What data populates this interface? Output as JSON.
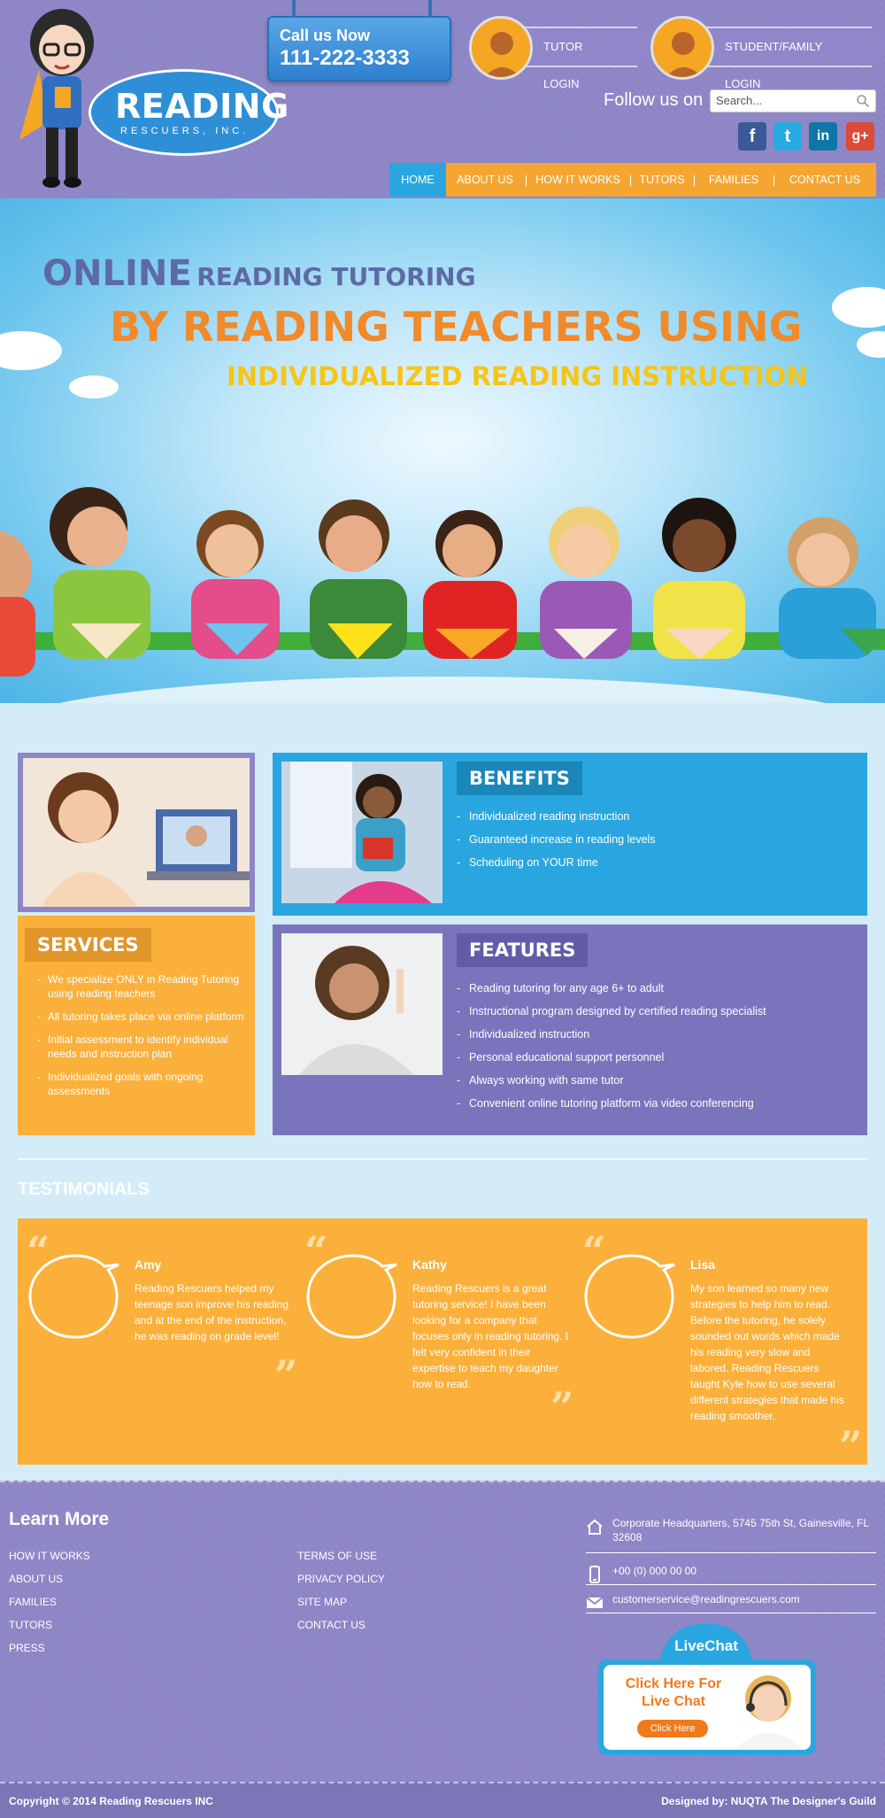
{
  "header": {
    "logo_main": "READING",
    "logo_sub": "RESCUERS, INC.",
    "call_label": "Call us Now",
    "call_number": "111-222-3333",
    "tutor_login": "TUTOR LOGIN",
    "student_login": "STUDENT/FAMILY LOGIN",
    "follow_label": "Follow us on",
    "search_placeholder": "Search...",
    "social": [
      {
        "icon": "facebook-icon",
        "glyph": "f",
        "color": "#3b5998"
      },
      {
        "icon": "twitter-icon",
        "glyph": "t",
        "color": "#29a9e1"
      },
      {
        "icon": "linkedin-icon",
        "glyph": "in",
        "color": "#0e76a8"
      },
      {
        "icon": "google-plus-icon",
        "glyph": "g+",
        "color": "#dd4b39"
      }
    ]
  },
  "nav": {
    "items": [
      "HOME",
      "ABOUT US",
      "HOW IT WORKS",
      "TUTORS",
      "FAMILIES",
      "CONTACT US"
    ],
    "active": "HOME"
  },
  "hero": {
    "line1_big": "ONLINE",
    "line1_small": "READING TUTORING",
    "line2": "BY READING TEACHERS USING",
    "line3": "INDIVIDUALIZED READING INSTRUCTION"
  },
  "services": {
    "title": "SERVICES",
    "items": [
      "We specialize ONLY in Reading Tutoring using reading teachers",
      "All tutoring takes place via online platform",
      "Initial assessment to identify individual needs and instruction plan",
      "Individualized goals with ongoing assessments"
    ]
  },
  "benefits": {
    "title": "BENEFITS",
    "items": [
      "Individualized reading instruction",
      "Guaranteed increase in reading levels",
      "Scheduling on YOUR time"
    ]
  },
  "features": {
    "title": "FEATURES",
    "items": [
      "Reading tutoring for any age 6+ to adult",
      "Instructional program designed by certified reading specialist",
      "Individualized instruction",
      "Personal educational support personnel",
      "Always working with same tutor",
      "Convenient online tutoring platform via video conferencing"
    ]
  },
  "testimonials": {
    "title": "TESTIMONIALS",
    "items": [
      {
        "name": "Amy",
        "text": "Reading Rescuers helped my teenage son improve his reading and at the end of the instruction, he was reading on grade level!"
      },
      {
        "name": "Kathy",
        "text": "Reading Rescuers is a great tutoring service! I have been looking for a company that focuses only in reading tutoring. I felt very confident in their expertise to teach my daughter how to read."
      },
      {
        "name": "Lisa",
        "text": "My son learned so many new strategies to help him to read. Before the tutoring, he solely sounded out words which made his reading very slow and labored. Reading Rescuers taught Kyle how to use several different strategies that made his reading smoother."
      }
    ]
  },
  "footer": {
    "learn_title": "Learn More",
    "col1": [
      "HOW IT WORKS",
      "ABOUT US",
      "FAMILIES",
      "TUTORS",
      "PRESS"
    ],
    "col2": [
      "TERMS OF USE",
      "PRIVACY POLICY",
      "SITE MAP",
      "CONTACT US"
    ],
    "address": "Corporate Headquarters, 5745 75th St, Gainesville, FL 32608",
    "phone": "+00 (0) 000 00 00",
    "email": "customerservice@readingrescuers.com",
    "livechat_tab": "LiveChat",
    "livechat_text": "Click Here For Live Chat",
    "livechat_button": "Click Here",
    "copyright": "Copyright © 2014 Reading Rescuers INC",
    "designed_by": "Designed by: NUQTA The Designer's Guild"
  }
}
